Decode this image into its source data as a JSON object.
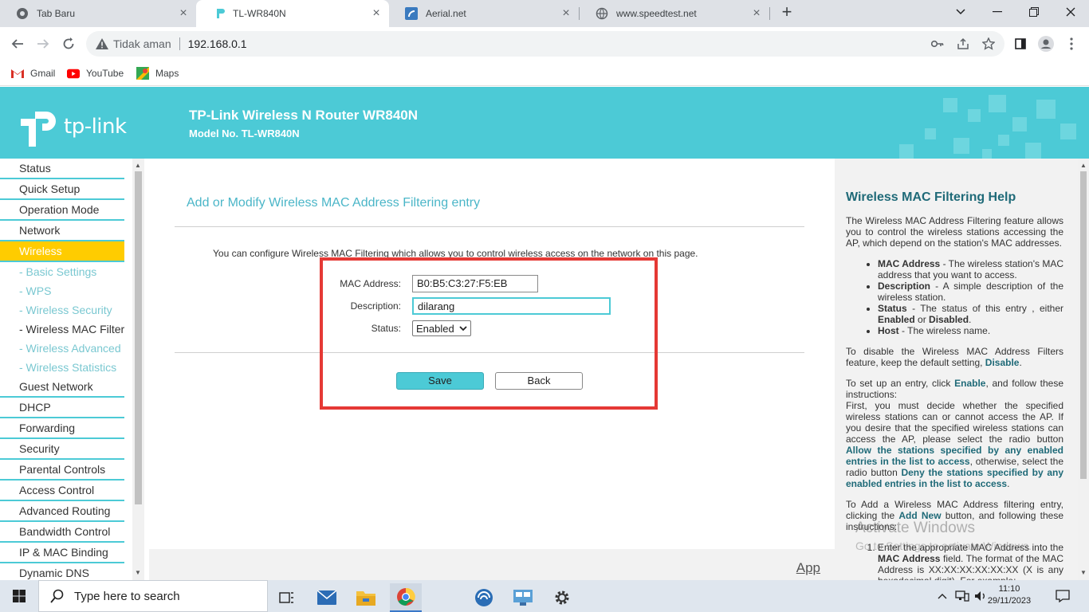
{
  "browser": {
    "tabs": [
      {
        "title": "Tab Baru",
        "icon": "chrome-icon"
      },
      {
        "title": "TL-WR840N",
        "icon": "tplink-icon"
      },
      {
        "title": "Aerial.net",
        "icon": "aerial-icon"
      },
      {
        "title": "www.speedtest.net",
        "icon": "globe-icon"
      }
    ],
    "address": {
      "security_label": "Tidak aman",
      "url": "192.168.0.1"
    },
    "bookmarks": [
      {
        "label": "Gmail",
        "icon": "gmail-icon"
      },
      {
        "label": "YouTube",
        "icon": "youtube-icon"
      },
      {
        "label": "Maps",
        "icon": "maps-icon"
      }
    ]
  },
  "router": {
    "brand": "tp-link",
    "title": "TP-Link Wireless N Router WR840N",
    "model": "Model No. TL-WR840N",
    "menu": {
      "items_top": [
        "Status",
        "Quick Setup",
        "Operation Mode",
        "Network"
      ],
      "active": "Wireless",
      "sub_items": [
        "- Basic Settings",
        "- WPS",
        "- Wireless Security",
        "- Wireless MAC Filtering",
        "- Wireless Advanced",
        "- Wireless Statistics"
      ],
      "items_bottom": [
        "Guest Network",
        "DHCP",
        "Forwarding",
        "Security",
        "Parental Controls",
        "Access Control",
        "Advanced Routing",
        "Bandwidth Control",
        "IP & MAC Binding",
        "Dynamic DNS"
      ]
    },
    "content": {
      "title": "Add or Modify Wireless MAC Address Filtering entry",
      "intro": "You can configure Wireless MAC Filtering which allows you to control wireless access on the network on this page.",
      "mac_label": "MAC Address:",
      "mac_value": "B0:B5:C3:27:F5:EB",
      "desc_label": "Description:",
      "desc_value": "dilarang",
      "status_label": "Status:",
      "status_value": "Enabled",
      "save": "Save",
      "back": "Back",
      "apply": "App"
    },
    "help": {
      "title": "Wireless MAC Filtering Help",
      "p1": "The Wireless MAC Address Filtering feature allows you to control the wireless stations accessing the AP, which depend on the station's MAC addresses.",
      "b1_key": "MAC Address",
      "b1_text": " - The wireless station's MAC address that you want to access.",
      "b2_key": "Description",
      "b2_text": " - A simple description of the wireless station.",
      "b3_key": "Status",
      "b3_text": " - The status of this entry , either ",
      "b3_en": "Enabled",
      "b3_or": " or ",
      "b3_dis": "Disabled",
      "b3_end": ".",
      "b4_key": "Host",
      "b4_text": " - The wireless name.",
      "p2": "To disable the Wireless MAC Address Filters feature, keep the default setting, ",
      "p2_kw": "Disable",
      "p2_end": ".",
      "p3a": "To set up an entry, click ",
      "p3_kw": "Enable",
      "p3b": ", and follow these instructions:",
      "p3c": "First, you must decide whether the specified wireless stations can or cannot access the AP. If you desire that the specified wireless stations can access the AP, please select the radio button ",
      "p3_kw2": "Allow the stations specified by any enabled entries in the list to access",
      "p3d": ", otherwise, select the radio button ",
      "p3_kw3": "Deny the stations specified by any enabled entries in the list to access",
      "p3e": ".",
      "p4a": "To Add a Wireless MAC Address filtering entry, clicking the ",
      "p4_kw": "Add New",
      "p4b": " button, and following these instructions:",
      "o1a": "Enter the appropriate MAC Address into the ",
      "o1_kw": "MAC Address",
      "o1b": " field. The format of the MAC Address is XX:XX:XX:XX:XX:XX (X is any hexadecimal digit). For example:"
    },
    "watermark": {
      "line1": "Activate Windows",
      "line2": "Go to Settings to activate Windows."
    }
  },
  "taskbar": {
    "search_placeholder": "Type here to search",
    "time": "11:10",
    "date": "29/11/2023"
  }
}
